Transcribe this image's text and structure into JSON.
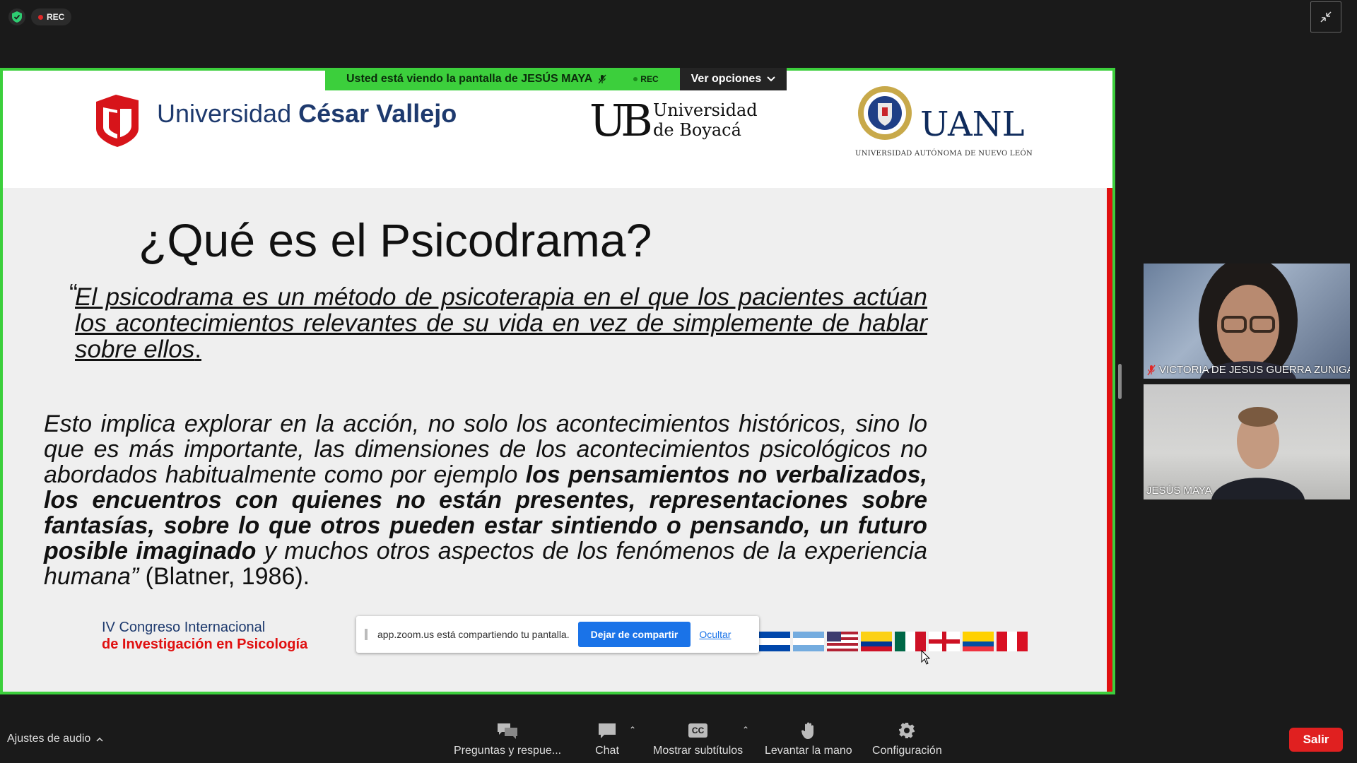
{
  "indicators": {
    "rec_label": "REC"
  },
  "share_banner": {
    "viewing_text": "Usted está viendo la pantalla de  JESÚS MAYA",
    "rec_label": "REC",
    "options_label": "Ver opciones"
  },
  "slide": {
    "header": {
      "ucv_name_regular": "Universidad ",
      "ucv_name_bold": "César Vallejo",
      "ub_mark": "UB",
      "ub_line1": "Universidad",
      "ub_line2": "de Boyacá",
      "uanl_name": "UANL",
      "uanl_subtitle": "UNIVERSIDAD AUTÓNOMA DE NUEVO LEÓN"
    },
    "title": "¿Qué es el Psicodrama?",
    "quote_open": "“",
    "quote": "El psicodrama es un método de psicoterapia en el que los pacientes actúan los acontecimientos relevantes de su vida en vez de simplemente de hablar sobre ellos",
    "quote_end": ".",
    "body_italic_1": "Esto implica explorar en la acción, no solo los acontecimientos históricos, sino lo que es más importante, las dimensiones de los acontecimientos psicológicos no abordados habitualmente como por ejemplo ",
    "body_bold": "los pensamientos no verbalizados, los encuentros con quienes no están presentes, representaciones sobre fantasías, sobre lo que otros pueden estar sintiendo o pensando, un futuro posible imaginado",
    "body_italic_2": " y muchos otros aspectos de los fenómenos de la experiencia humana”",
    "citation": " (Blatner, 1986).",
    "congress_line1": "IV Congreso Internacional",
    "congress_line2": "de Investigación en Psicología"
  },
  "share_toast": {
    "message": "app.zoom.us está compartiendo tu pantalla.",
    "stop_label": "Dejar de compartir",
    "hide_label": "Ocultar"
  },
  "participants": [
    {
      "name": "VICTORIA DE JESUS GUERRA ZUNIGA",
      "muted": true
    },
    {
      "name": "JESÚS MAYA",
      "muted": false
    }
  ],
  "toolbar": {
    "audio_settings": "Ajustes de audio",
    "qa": "Preguntas y respue...",
    "chat": "Chat",
    "captions": "Mostrar subtítulos",
    "cc_icon_text": "CC",
    "raise_hand": "Levantar la mano",
    "settings": "Configuración",
    "leave": "Salir"
  },
  "colors": {
    "share_border": "#3ccf3c",
    "leave": "#e02020",
    "toast_button": "#1a73e8",
    "slide_accent": "#e01010"
  }
}
